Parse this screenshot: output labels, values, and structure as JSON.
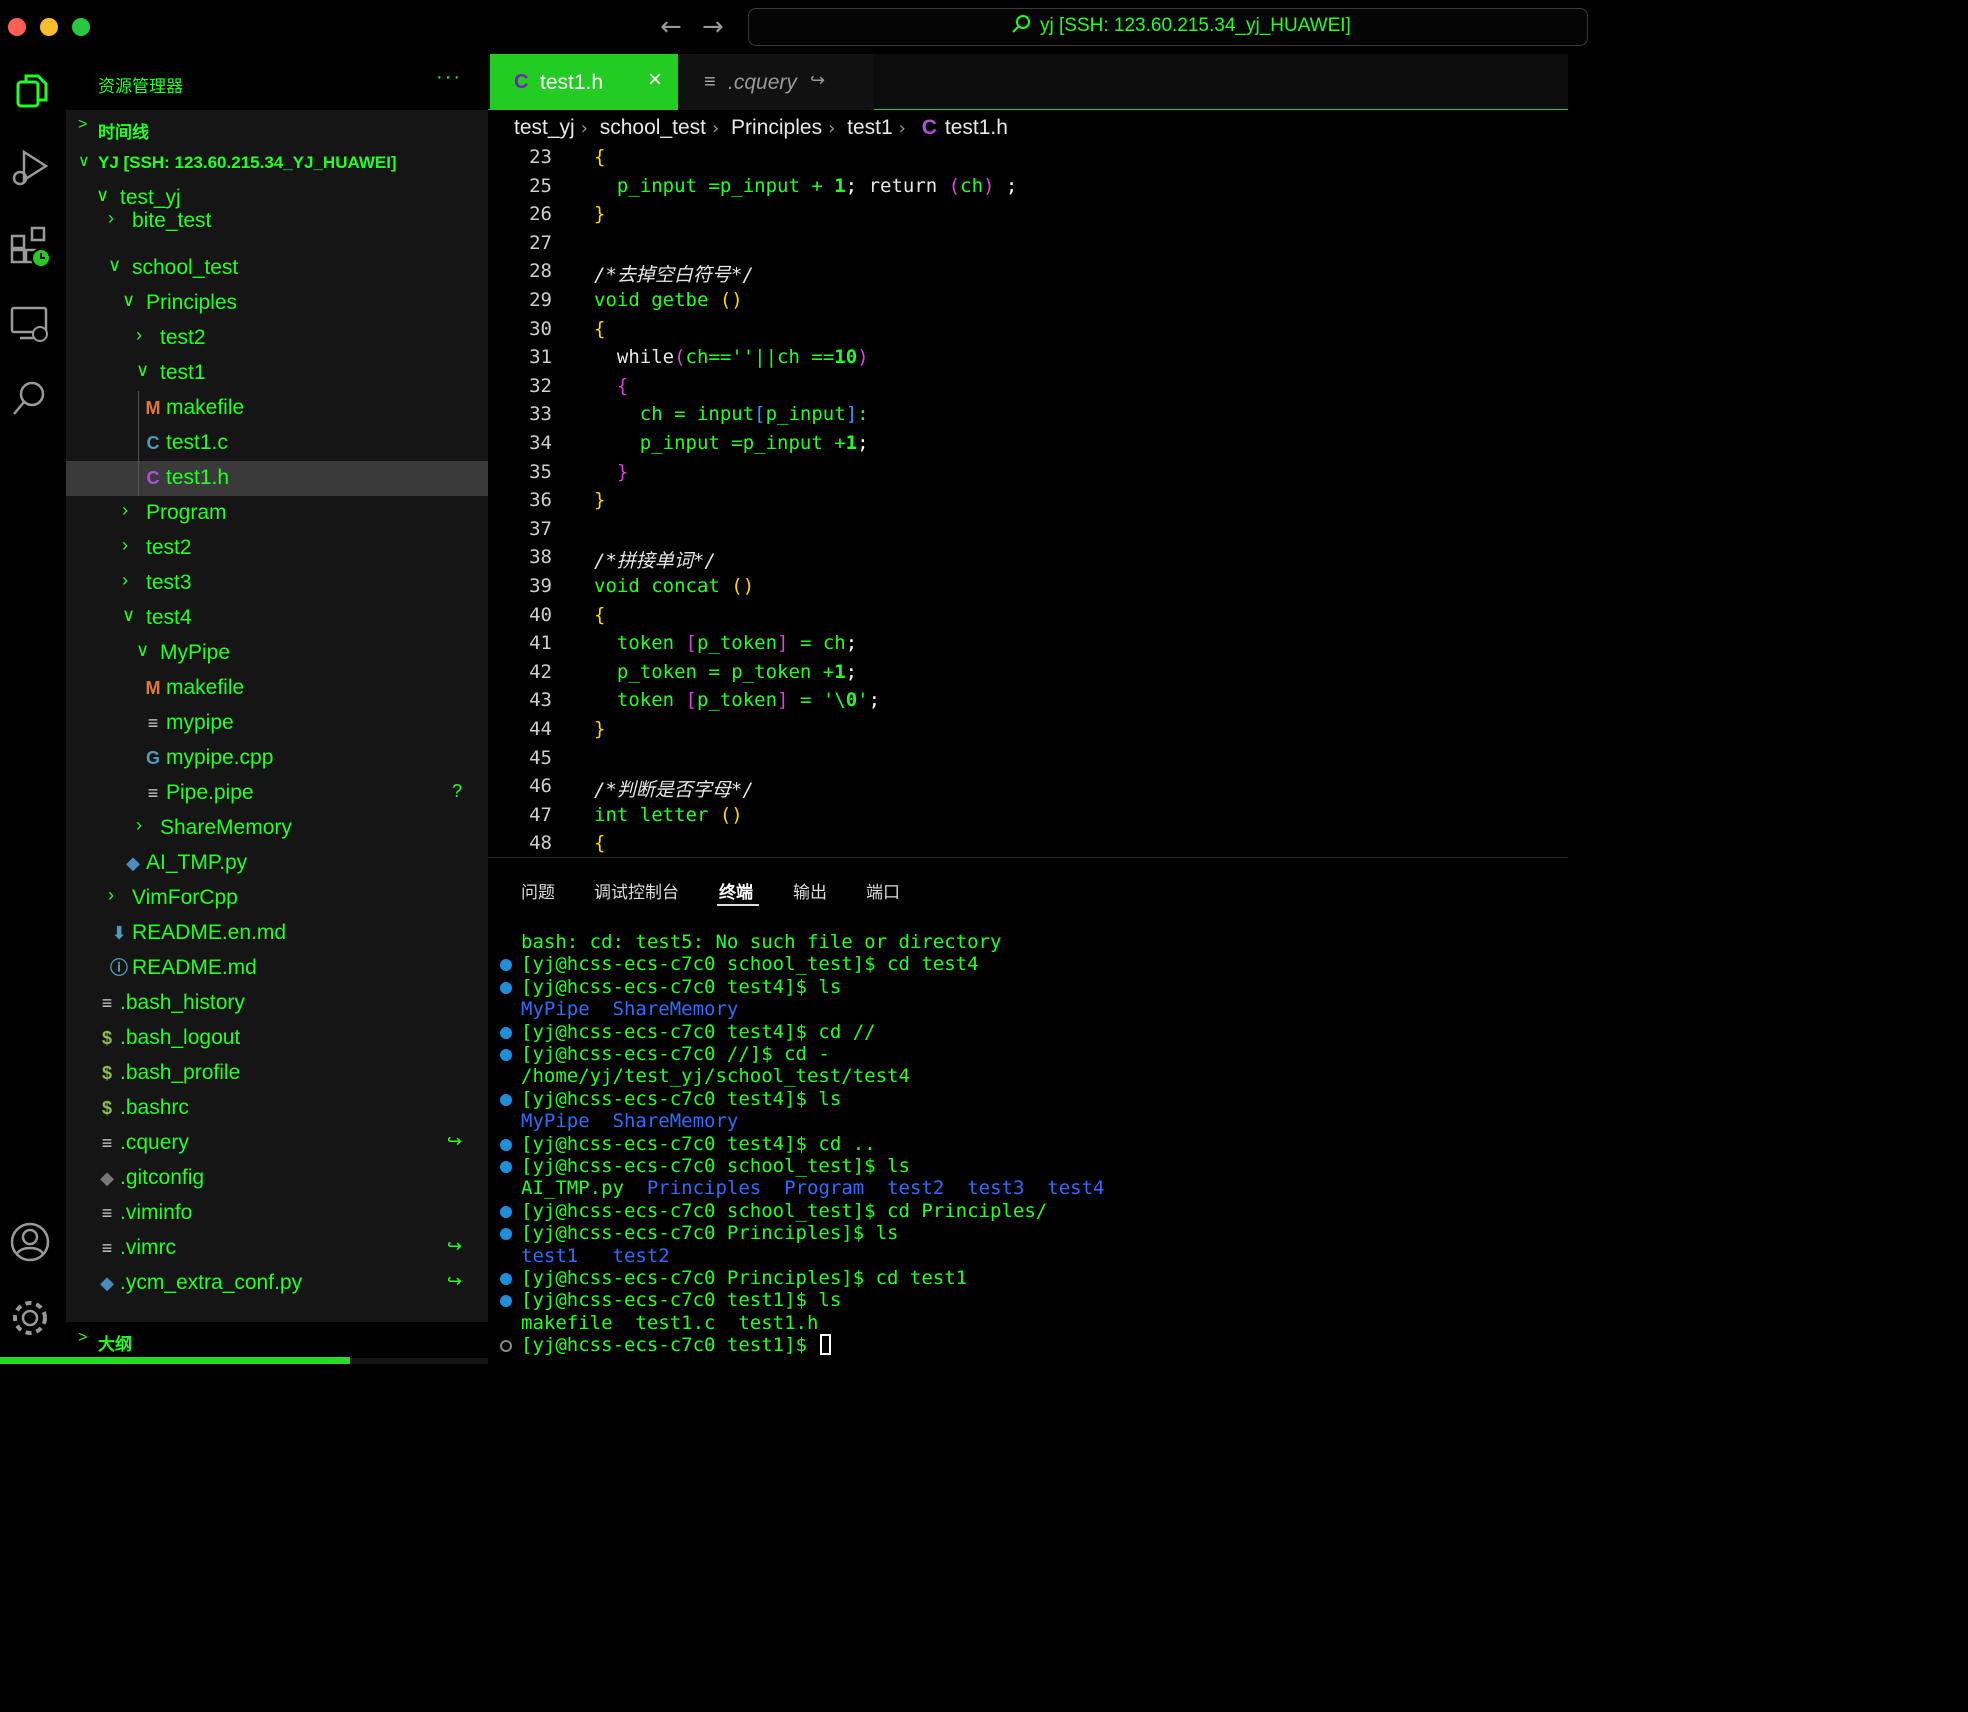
{
  "titlebar": {
    "back_icon": "arrow-left-icon",
    "forward_icon": "arrow-right-icon",
    "command_center": "yj [SSH: 123.60.215.34_yj_HUAWEI]"
  },
  "activity_bar": {
    "items": [
      "explorer-icon",
      "run-debug-icon",
      "extensions-icon",
      "remote-explorer-icon",
      "search-icon",
      "account-icon",
      "settings-gear-icon"
    ]
  },
  "sidebar": {
    "title": "资源管理器",
    "more": "···",
    "timeline_label": "时间线",
    "workspace_label": "YJ [SSH: 123.60.215.34_YJ_HUAWEI]",
    "outline_label": "大纲",
    "tree": [
      {
        "label": "test_yj",
        "icon": "chevron-down",
        "indent": 0
      },
      {
        "label": "bite_test",
        "icon": "chevron-right",
        "indent": 1
      },
      {
        "label": "school_test",
        "icon": "chevron-down",
        "indent": 1
      },
      {
        "label": "Principles",
        "icon": "chevron-down",
        "indent": 2
      },
      {
        "label": "test2",
        "icon": "chevron-right",
        "indent": 3
      },
      {
        "label": "test1",
        "icon": "chevron-down",
        "indent": 3
      },
      {
        "label": "makefile",
        "icon": "M",
        "indent": 4
      },
      {
        "label": "test1.c",
        "icon": "C",
        "indent": 4
      },
      {
        "label": "test1.h",
        "icon": "C",
        "indent": 4,
        "selected": true
      },
      {
        "label": "Program",
        "icon": "chevron-right",
        "indent": 2
      },
      {
        "label": "test2",
        "icon": "chevron-right",
        "indent": 2
      },
      {
        "label": "test3",
        "icon": "chevron-right",
        "indent": 2
      },
      {
        "label": "test4",
        "icon": "chevron-down",
        "indent": 2
      },
      {
        "label": "MyPipe",
        "icon": "chevron-down",
        "indent": 3
      },
      {
        "label": "makefile",
        "icon": "M",
        "indent": 4
      },
      {
        "label": "mypipe",
        "icon": "lines",
        "indent": 4
      },
      {
        "label": "mypipe.cpp",
        "icon": "G",
        "indent": 4
      },
      {
        "label": "Pipe.pipe",
        "icon": "lines",
        "indent": 4,
        "decoration": "?"
      },
      {
        "label": "ShareMemory",
        "icon": "chevron-right",
        "indent": 3
      },
      {
        "label": "AI_TMP.py",
        "icon": "python",
        "indent": 2
      },
      {
        "label": "VimForCpp",
        "icon": "chevron-right",
        "indent": 1
      },
      {
        "label": "README.en.md",
        "icon": "download",
        "indent": 1
      },
      {
        "label": "README.md",
        "icon": "info",
        "indent": 1
      },
      {
        "label": ".bash_history",
        "icon": "lines",
        "indent": 0
      },
      {
        "label": ".bash_logout",
        "icon": "$",
        "indent": 0
      },
      {
        "label": ".bash_profile",
        "icon": "$",
        "indent": 0
      },
      {
        "label": ".bashrc",
        "icon": "$",
        "indent": 0
      },
      {
        "label": ".cquery",
        "icon": "lines",
        "indent": 0,
        "decoration": "↪"
      },
      {
        "label": ".gitconfig",
        "icon": "git",
        "indent": 0
      },
      {
        "label": ".viminfo",
        "icon": "lines",
        "indent": 0
      },
      {
        "label": ".vimrc",
        "icon": "lines",
        "indent": 0,
        "decoration": "↪"
      },
      {
        "label": ".ycm_extra_conf.py",
        "icon": "python",
        "indent": 0,
        "decoration": "↪"
      }
    ]
  },
  "editor": {
    "tabs": [
      {
        "label": "test1.h",
        "icon": "C",
        "active": true,
        "close": "×"
      },
      {
        "label": ".cquery",
        "icon": "lines",
        "active": false,
        "close": "↪"
      }
    ],
    "breadcrumb": [
      "test_yj",
      "school_test",
      "Principles",
      "test1",
      "test1.h"
    ],
    "lines": [
      {
        "n": "23",
        "code": "{"
      },
      {
        "n": "25",
        "code": "  p_input =p_input + 1; return (ch) ;"
      },
      {
        "n": "26",
        "code": "}"
      },
      {
        "n": "27",
        "code": ""
      },
      {
        "n": "28",
        "code": "/*去掉空白符号*/"
      },
      {
        "n": "29",
        "code": "void getbe ()"
      },
      {
        "n": "30",
        "code": "{"
      },
      {
        "n": "31",
        "code": "  while(ch==''||ch ==10)"
      },
      {
        "n": "32",
        "code": "  {"
      },
      {
        "n": "33",
        "code": "    ch = input[p_input]:"
      },
      {
        "n": "34",
        "code": "    p_input =p_input +1;"
      },
      {
        "n": "35",
        "code": "  }"
      },
      {
        "n": "36",
        "code": "}"
      },
      {
        "n": "37",
        "code": ""
      },
      {
        "n": "38",
        "code": "/*拼接单词*/"
      },
      {
        "n": "39",
        "code": "void concat ()"
      },
      {
        "n": "40",
        "code": "{"
      },
      {
        "n": "41",
        "code": "  token [p_token] = ch;"
      },
      {
        "n": "42",
        "code": "  p_token = p_token +1;"
      },
      {
        "n": "43",
        "code": "  token [p_token] = '\\0';"
      },
      {
        "n": "44",
        "code": "}"
      },
      {
        "n": "45",
        "code": ""
      },
      {
        "n": "46",
        "code": "/*判断是否字母*/"
      },
      {
        "n": "47",
        "code": "int letter ()"
      },
      {
        "n": "48",
        "code": "{"
      }
    ]
  },
  "panel": {
    "tabs": [
      "问题",
      "调试控制台",
      "终端",
      "输出",
      "端口"
    ],
    "active_tab": "终端",
    "terminal": [
      {
        "dot": "none",
        "text": "bash: cd: test5: No such file or directory",
        "kind": "out"
      },
      {
        "dot": "filled",
        "text": "[yj@hcss-ecs-c7c0 school_test]$ cd test4",
        "kind": "cmd"
      },
      {
        "dot": "filled",
        "text": "[yj@hcss-ecs-c7c0 test4]$ ls",
        "kind": "cmd"
      },
      {
        "dot": "none",
        "text": "MyPipe  ShareMemory",
        "kind": "dir"
      },
      {
        "dot": "filled",
        "text": "[yj@hcss-ecs-c7c0 test4]$ cd //",
        "kind": "cmd"
      },
      {
        "dot": "filled",
        "text": "[yj@hcss-ecs-c7c0 //]$ cd -",
        "kind": "cmd"
      },
      {
        "dot": "none",
        "text": "/home/yj/test_yj/school_test/test4",
        "kind": "out"
      },
      {
        "dot": "filled",
        "text": "[yj@hcss-ecs-c7c0 test4]$ ls",
        "kind": "cmd"
      },
      {
        "dot": "none",
        "text": "MyPipe  ShareMemory",
        "kind": "dir"
      },
      {
        "dot": "filled",
        "text": "[yj@hcss-ecs-c7c0 test4]$ cd ..",
        "kind": "cmd"
      },
      {
        "dot": "filled",
        "text": "[yj@hcss-ecs-c7c0 school_test]$ ls",
        "kind": "cmd"
      },
      {
        "dot": "none",
        "text": "AI_TMP.py  Principles  Program  test2  test3  test4",
        "kind": "mixed"
      },
      {
        "dot": "filled",
        "text": "[yj@hcss-ecs-c7c0 school_test]$ cd Principles/",
        "kind": "cmd"
      },
      {
        "dot": "filled",
        "text": "[yj@hcss-ecs-c7c0 Principles]$ ls",
        "kind": "cmd"
      },
      {
        "dot": "none",
        "text": "test1   test2",
        "kind": "dir"
      },
      {
        "dot": "filled",
        "text": "[yj@hcss-ecs-c7c0 Principles]$ cd test1",
        "kind": "cmd"
      },
      {
        "dot": "filled",
        "text": "[yj@hcss-ecs-c7c0 test1]$ ls",
        "kind": "cmd"
      },
      {
        "dot": "none",
        "text": "makefile  test1.c  test1.h",
        "kind": "out"
      },
      {
        "dot": "hollow",
        "text": "[yj@hcss-ecs-c7c0 test1]$ ",
        "kind": "prompt"
      }
    ]
  },
  "colors": {
    "accent_green": "#22ff22",
    "tab_active_bg": "#22cc22",
    "keyword_green": "#22ff22",
    "bracket_yellow": "#ffd700",
    "bracket_magenta": "#da44da",
    "terminal_dir_blue": "#2f6cff",
    "dot_blue": "#1f8fdb"
  }
}
